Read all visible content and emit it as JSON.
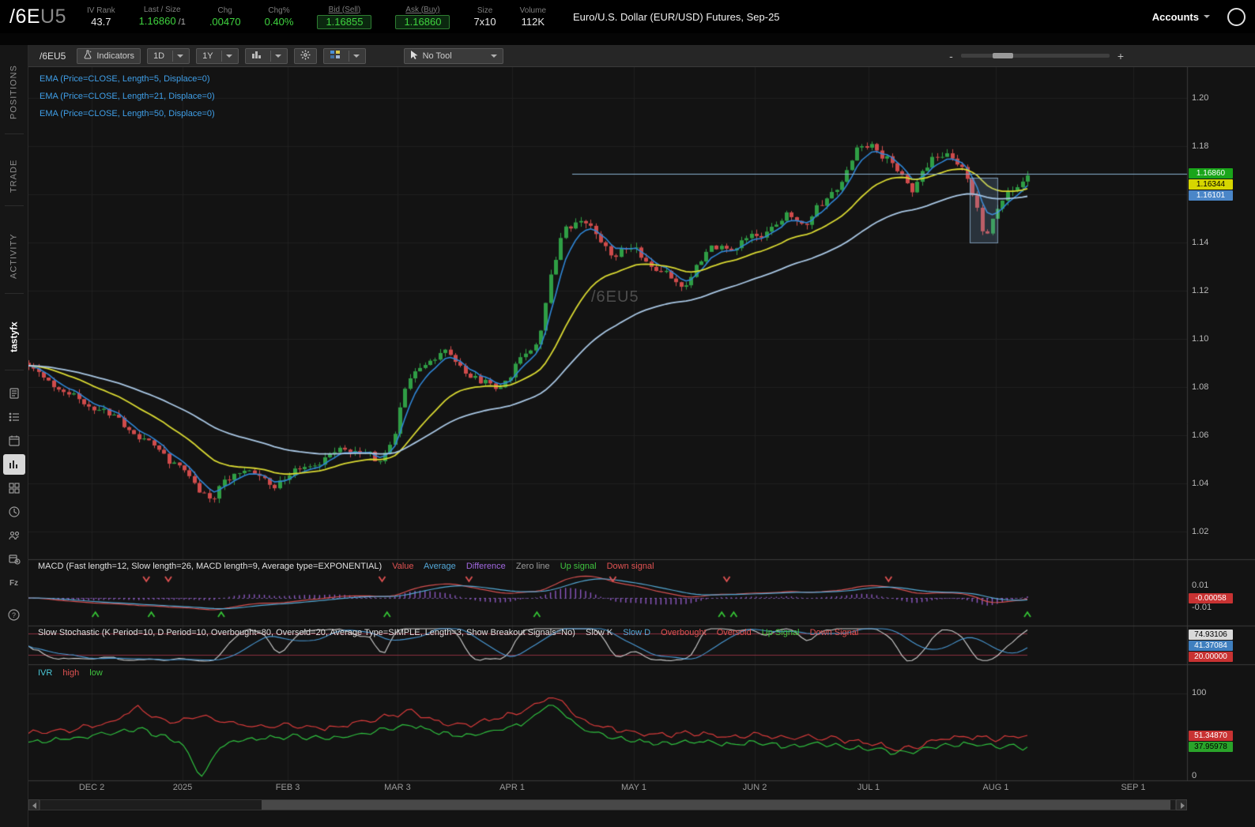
{
  "header": {
    "symbol": "/6E",
    "symbol_suffix": "U5",
    "fields": [
      {
        "label": "IV Rank",
        "value": "43.7"
      },
      {
        "label": "Last / Size",
        "value": "1.16860",
        "suffix": " /1"
      },
      {
        "label": "Chg",
        "value": ".00470"
      },
      {
        "label": "Chg%",
        "value": "0.40%"
      },
      {
        "label": "Bid (Sell)",
        "value": "1.16855"
      },
      {
        "label": "Ask (Buy)",
        "value": "1.16860"
      },
      {
        "label": "Size",
        "value": "7x10"
      },
      {
        "label": "Volume",
        "value": "112K"
      }
    ],
    "description": "Euro/U.S. Dollar (EUR/USD) Futures, Sep-25",
    "accounts_label": "Accounts"
  },
  "toolbar": {
    "symbol": "/6EU5",
    "indicators": "Indicators",
    "timeframe": "1D",
    "range": "1Y",
    "tool": "No Tool",
    "zoom_out": "-",
    "zoom_in": "+"
  },
  "sidebar": {
    "tabs": [
      "POSITIONS",
      "TRADE",
      "ACTIVITY",
      "tastyfx"
    ],
    "icons": [
      "notes-icon",
      "watchlist-icon",
      "calendar-icon",
      "chart-icon",
      "grid-icon",
      "history-icon",
      "contacts-icon",
      "events-icon",
      "fx-icon",
      "help-icon"
    ],
    "fx_label": "Fz",
    "help_label": "?"
  },
  "chart": {
    "studies": [
      "EMA (Price=CLOSE, Length=5, Displace=0)",
      "EMA (Price=CLOSE, Length=21, Displace=0)",
      "EMA (Price=CLOSE, Length=50, Displace=0)"
    ],
    "watermark": "/6EU5",
    "price_axis": [
      "1.20",
      "1.18",
      "1.16",
      "1.14",
      "1.12",
      "1.10",
      "1.08",
      "1.06",
      "1.04",
      "1.02"
    ],
    "date_axis": [
      "DEC 2",
      "2025",
      "FEB 3",
      "MAR 3",
      "APR 1",
      "MAY 1",
      "JUN 2",
      "JUL 1",
      "AUG 1",
      "SEP 1"
    ],
    "price_boxes": [
      {
        "value": "1.16860",
        "color": "#1aa51a"
      },
      {
        "value": "1.16344",
        "color": "#d6d600"
      },
      {
        "value": "1.16101",
        "color": "#4a86c8"
      }
    ]
  },
  "macd": {
    "label": "MACD (Fast length=12, Slow length=26, MACD length=9, Average type=EXPONENTIAL)",
    "legend": [
      "Value",
      "Average",
      "Difference",
      "Zero line",
      "Up signal",
      "Down signal"
    ],
    "axis": [
      "0.01",
      "-0.01"
    ],
    "value_box": "-0.00058"
  },
  "stoch": {
    "label": "Slow Stochastic (K Period=10, D Period=10, Overbought=80, Oversold=20, Average Type=SIMPLE, Length=3, Show Breakout Signals=No)",
    "legend": [
      "Slow K",
      "Slow D",
      "Overbought",
      "Oversold",
      "Up Signal",
      "Down Signal"
    ],
    "boxes": [
      "74.93106",
      "41.37084",
      "20.00000"
    ]
  },
  "ivr": {
    "label": "IVR",
    "legend_high": "high",
    "legend_low": "low",
    "axis": [
      "100",
      "0"
    ],
    "boxes": [
      "51.34870",
      "37.95978"
    ]
  },
  "chart_data": {
    "type": "candlestick",
    "symbol": "/6EU5",
    "title": "Euro/U.S. Dollar (EUR/USD) Futures, Sep-25, 1Y daily",
    "ylim": [
      1.02,
      1.2
    ],
    "current_price": 1.1686,
    "ema_values": {
      "ema21": 1.16344,
      "ema50": 1.16101
    },
    "candle_count": 200,
    "price_anchors": [
      [
        0.0,
        1.088
      ],
      [
        0.031,
        1.079
      ],
      [
        0.051,
        1.0745
      ],
      [
        0.07,
        1.071
      ],
      [
        0.098,
        1.064
      ],
      [
        0.118,
        1.057
      ],
      [
        0.142,
        1.05
      ],
      [
        0.157,
        1.044
      ],
      [
        0.173,
        1.037
      ],
      [
        0.185,
        1.034
      ],
      [
        0.201,
        1.042
      ],
      [
        0.217,
        1.047
      ],
      [
        0.24,
        1.039
      ],
      [
        0.256,
        1.042
      ],
      [
        0.284,
        1.048
      ],
      [
        0.304,
        1.052
      ],
      [
        0.327,
        1.055
      ],
      [
        0.351,
        1.048
      ],
      [
        0.367,
        1.062
      ],
      [
        0.379,
        1.082
      ],
      [
        0.391,
        1.088
      ],
      [
        0.403,
        1.092
      ],
      [
        0.422,
        1.094
      ],
      [
        0.434,
        1.088
      ],
      [
        0.45,
        1.082
      ],
      [
        0.474,
        1.08
      ],
      [
        0.49,
        1.09
      ],
      [
        0.502,
        1.095
      ],
      [
        0.51,
        1.1
      ],
      [
        0.525,
        1.13
      ],
      [
        0.537,
        1.145
      ],
      [
        0.553,
        1.15
      ],
      [
        0.569,
        1.142
      ],
      [
        0.585,
        1.135
      ],
      [
        0.604,
        1.138
      ],
      [
        0.62,
        1.132
      ],
      [
        0.64,
        1.125
      ],
      [
        0.656,
        1.122
      ],
      [
        0.672,
        1.132
      ],
      [
        0.692,
        1.14
      ],
      [
        0.707,
        1.137
      ],
      [
        0.723,
        1.143
      ],
      [
        0.743,
        1.145
      ],
      [
        0.763,
        1.152
      ],
      [
        0.779,
        1.148
      ],
      [
        0.798,
        1.158
      ],
      [
        0.814,
        1.166
      ],
      [
        0.83,
        1.178
      ],
      [
        0.842,
        1.182
      ],
      [
        0.854,
        1.176
      ],
      [
        0.869,
        1.17
      ],
      [
        0.885,
        1.163
      ],
      [
        0.901,
        1.172
      ],
      [
        0.917,
        1.178
      ],
      [
        0.933,
        1.172
      ],
      [
        0.949,
        1.155
      ],
      [
        0.957,
        1.142
      ],
      [
        0.968,
        1.152
      ],
      [
        0.98,
        1.16
      ],
      [
        0.992,
        1.165
      ],
      [
        1.0,
        1.1686
      ]
    ],
    "month_tick_fractions": [
      0.0546,
      0.133,
      0.2238,
      0.3185,
      0.4175,
      0.5225,
      0.6269,
      0.7251,
      0.8349,
      0.9536
    ],
    "macd_arrows_down": [
      0.118,
      0.14,
      0.354,
      0.441,
      0.585,
      0.699,
      0.861
    ],
    "macd_arrows_up": [
      0.067,
      0.123,
      0.193,
      0.359,
      0.509,
      0.694,
      0.706,
      1.0
    ],
    "ivr_high_anchors": [
      [
        0,
        55
      ],
      [
        0.04,
        58
      ],
      [
        0.08,
        66
      ],
      [
        0.11,
        84
      ],
      [
        0.125,
        72
      ],
      [
        0.15,
        66
      ],
      [
        0.17,
        74
      ],
      [
        0.2,
        66
      ],
      [
        0.23,
        61
      ],
      [
        0.26,
        64
      ],
      [
        0.3,
        60
      ],
      [
        0.33,
        66
      ],
      [
        0.36,
        74
      ],
      [
        0.385,
        80
      ],
      [
        0.41,
        67
      ],
      [
        0.44,
        64
      ],
      [
        0.47,
        72
      ],
      [
        0.49,
        78
      ],
      [
        0.505,
        85
      ],
      [
        0.52,
        97
      ],
      [
        0.535,
        90
      ],
      [
        0.55,
        72
      ],
      [
        0.58,
        60
      ],
      [
        0.61,
        55
      ],
      [
        0.64,
        52
      ],
      [
        0.67,
        55
      ],
      [
        0.7,
        50
      ],
      [
        0.73,
        53
      ],
      [
        0.76,
        48
      ],
      [
        0.79,
        50
      ],
      [
        0.82,
        46
      ],
      [
        0.85,
        42
      ],
      [
        0.87,
        34
      ],
      [
        0.89,
        40
      ],
      [
        0.91,
        47
      ],
      [
        0.94,
        50
      ],
      [
        0.97,
        48
      ],
      [
        1,
        51
      ]
    ],
    "ivr_low_anchors": [
      [
        0,
        44
      ],
      [
        0.04,
        48
      ],
      [
        0.08,
        54
      ],
      [
        0.11,
        60
      ],
      [
        0.125,
        54
      ],
      [
        0.15,
        46
      ],
      [
        0.165,
        20
      ],
      [
        0.175,
        3
      ],
      [
        0.19,
        38
      ],
      [
        0.21,
        46
      ],
      [
        0.24,
        49
      ],
      [
        0.27,
        51
      ],
      [
        0.3,
        48
      ],
      [
        0.33,
        53
      ],
      [
        0.36,
        60
      ],
      [
        0.385,
        64
      ],
      [
        0.41,
        54
      ],
      [
        0.44,
        51
      ],
      [
        0.47,
        58
      ],
      [
        0.49,
        64
      ],
      [
        0.505,
        72
      ],
      [
        0.52,
        88
      ],
      [
        0.535,
        80
      ],
      [
        0.55,
        62
      ],
      [
        0.58,
        50
      ],
      [
        0.61,
        45
      ],
      [
        0.64,
        42
      ],
      [
        0.67,
        45
      ],
      [
        0.7,
        41
      ],
      [
        0.73,
        44
      ],
      [
        0.76,
        39
      ],
      [
        0.79,
        42
      ],
      [
        0.82,
        38
      ],
      [
        0.85,
        36
      ],
      [
        0.87,
        31
      ],
      [
        0.89,
        35
      ],
      [
        0.91,
        40
      ],
      [
        0.94,
        42
      ],
      [
        0.97,
        40
      ],
      [
        1,
        38
      ]
    ],
    "colors": {
      "up": "#2f9e45",
      "down": "#cf4b4b",
      "ema5": "#2f86d6",
      "ema21": "#d9d932",
      "ema50": "#a9c7e4",
      "priceline": "#8ab4d4",
      "grid": "#202020",
      "macd_value": "#d65050",
      "macd_avg": "#55aad6",
      "macd_hist": "#9a5fd6",
      "stoch_k": "#cfcfcf",
      "stoch_d": "#4a9ad6",
      "ivr_high": "#d63a3a",
      "ivr_low": "#2fbf3f"
    }
  }
}
